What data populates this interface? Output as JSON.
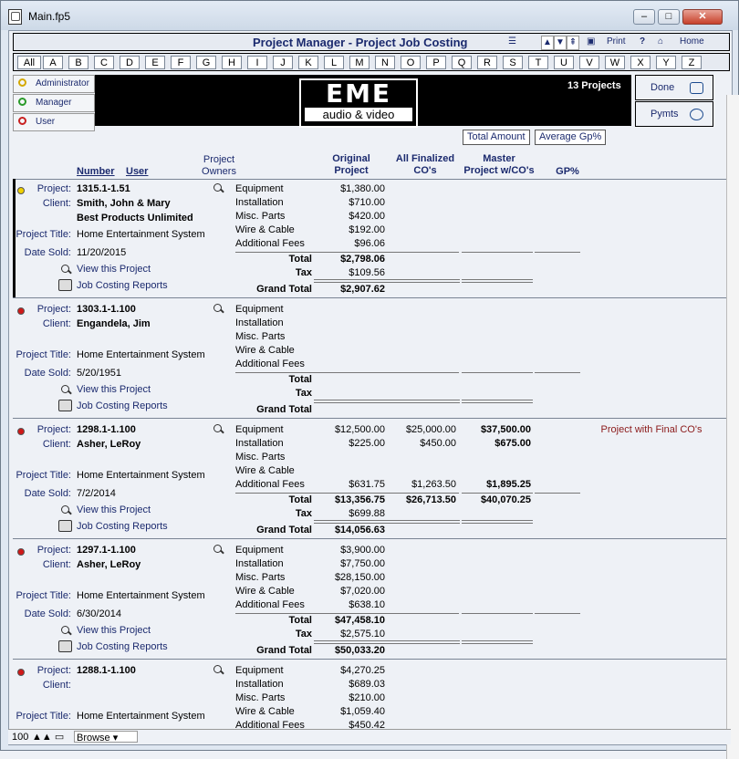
{
  "window": {
    "title": "Main.fp5"
  },
  "header": {
    "title": "Project Manager - Project Job Costing",
    "print": "Print",
    "help": "?",
    "home": "Home"
  },
  "alphabet": [
    "All",
    "A",
    "B",
    "C",
    "D",
    "E",
    "F",
    "G",
    "H",
    "I",
    "J",
    "K",
    "L",
    "M",
    "N",
    "O",
    "P",
    "Q",
    "R",
    "S",
    "T",
    "U",
    "V",
    "W",
    "X",
    "Y",
    "Z"
  ],
  "roles": [
    "Administrator",
    "Manager",
    "User"
  ],
  "logo": {
    "big": "EME",
    "small": "audio & video"
  },
  "project_count": "13 Projects",
  "buttons": {
    "done": "Done",
    "pymts": "Pymts",
    "total_amount": "Total Amount",
    "average_gp": "Average Gp%"
  },
  "columns": {
    "number": "Number",
    "user": "User",
    "owners_1": "Project",
    "owners_2": "Owners",
    "orig_1": "Original",
    "orig_2": "Project",
    "fin_1": "All Finalized",
    "fin_2": "CO's",
    "master_1": "Master",
    "master_2": "Project w/CO's",
    "gp": "GP%"
  },
  "labels": {
    "project": "Project:",
    "client": "Client:",
    "project_title": "Project Title:",
    "date_sold": "Date Sold:",
    "view": "View this Project",
    "reports": "Job Costing Reports",
    "total": "Total",
    "tax": "Tax",
    "grand_total": "Grand Total"
  },
  "categories": [
    "Equipment",
    "Installation",
    "Misc. Parts",
    "Wire & Cable",
    "Additional Fees"
  ],
  "records": [
    {
      "project": "1315.1-1.51",
      "client": "Smith, John & Mary",
      "client2": "Best Products Unlimited",
      "title": "Home Entertainment System",
      "date": "11/20/2015",
      "dot": "#f0d000",
      "orig": [
        "$1,380.00",
        "$710.00",
        "$420.00",
        "$192.00",
        "$96.06"
      ],
      "fin": [
        "",
        "",
        "",
        "",
        ""
      ],
      "master": [
        "",
        "",
        "",
        "",
        ""
      ],
      "orig_total": "$2,798.06",
      "orig_tax": "$109.56",
      "orig_grand": "$2,907.62",
      "fin_total": "",
      "master_total": "",
      "note": ""
    },
    {
      "project": "1303.1-1.100",
      "client": "Engandela, Jim",
      "client2": "",
      "title": "Home Entertainment System",
      "date": "5/20/1951",
      "dot": "#d01818",
      "orig": [
        "",
        "",
        "",
        "",
        ""
      ],
      "fin": [
        "",
        "",
        "",
        "",
        ""
      ],
      "master": [
        "",
        "",
        "",
        "",
        ""
      ],
      "orig_total": "",
      "orig_tax": "",
      "orig_grand": "",
      "fin_total": "",
      "master_total": "",
      "note": ""
    },
    {
      "project": "1298.1-1.100",
      "client": "Asher, LeRoy",
      "client2": "",
      "title": "Home Entertainment System",
      "date": "7/2/2014",
      "dot": "#d01818",
      "orig": [
        "$12,500.00",
        "$225.00",
        "",
        "",
        "$631.75"
      ],
      "fin": [
        "$25,000.00",
        "$450.00",
        "",
        "",
        "$1,263.50"
      ],
      "master": [
        "$37,500.00",
        "$675.00",
        "",
        "",
        "$1,895.25"
      ],
      "orig_total": "$13,356.75",
      "orig_tax": "$699.88",
      "orig_grand": "$14,056.63",
      "fin_total": "$26,713.50",
      "master_total": "$40,070.25",
      "note": "Project with Final CO's"
    },
    {
      "project": "1297.1-1.100",
      "client": "Asher, LeRoy",
      "client2": "",
      "title": "Home Entertainment System",
      "date": "6/30/2014",
      "dot": "#d01818",
      "orig": [
        "$3,900.00",
        "$7,750.00",
        "$28,150.00",
        "$7,020.00",
        "$638.10"
      ],
      "fin": [
        "",
        "",
        "",
        "",
        ""
      ],
      "master": [
        "",
        "",
        "",
        "",
        ""
      ],
      "orig_total": "$47,458.10",
      "orig_tax": "$2,575.10",
      "orig_grand": "$50,033.20",
      "fin_total": "",
      "master_total": "",
      "note": ""
    },
    {
      "project": "1288.1-1.100",
      "client": "",
      "client2": "",
      "title": "Home Entertainment System",
      "date": "",
      "dot": "#d01818",
      "orig": [
        "$4,270.25",
        "$689.03",
        "$210.00",
        "$1,059.40",
        "$450.42"
      ],
      "fin": [
        "",
        "",
        "",
        "",
        ""
      ],
      "master": [
        "",
        "",
        "",
        "",
        ""
      ],
      "orig_total": "",
      "orig_tax": "",
      "orig_grand": "",
      "fin_total": "",
      "master_total": "",
      "note": ""
    }
  ],
  "status": {
    "zoom": "100",
    "mode": "Browse"
  }
}
